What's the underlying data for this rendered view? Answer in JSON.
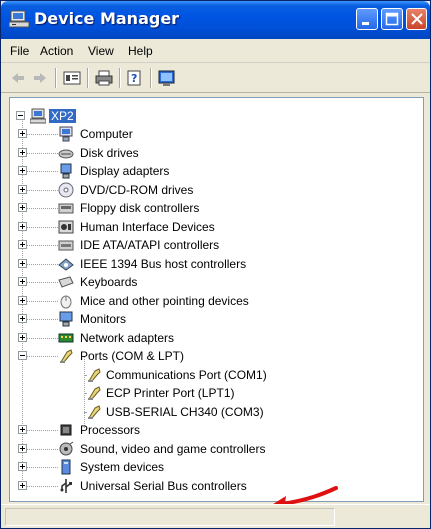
{
  "window": {
    "title": "Device Manager",
    "title_icon": "device-manager-icon"
  },
  "menu": [
    "File",
    "Action",
    "View",
    "Help"
  ],
  "toolbar": [
    "back-icon",
    "forward-icon",
    "properties-view-icon",
    "print-icon",
    "help-icon",
    "scan-hardware-icon"
  ],
  "tree": {
    "root": "XP2",
    "items": [
      {
        "label": "Computer",
        "icon": "computer-icon"
      },
      {
        "label": "Disk drives",
        "icon": "disk-drive-icon"
      },
      {
        "label": "Display adapters",
        "icon": "display-adapter-icon"
      },
      {
        "label": "DVD/CD-ROM drives",
        "icon": "dvd-drive-icon"
      },
      {
        "label": "Floppy disk controllers",
        "icon": "floppy-controller-icon"
      },
      {
        "label": "Human Interface Devices",
        "icon": "hid-icon"
      },
      {
        "label": "IDE ATA/ATAPI controllers",
        "icon": "ide-controller-icon"
      },
      {
        "label": "IEEE 1394 Bus host controllers",
        "icon": "ieee1394-icon"
      },
      {
        "label": "Keyboards",
        "icon": "keyboard-icon"
      },
      {
        "label": "Mice and other pointing devices",
        "icon": "mouse-icon"
      },
      {
        "label": "Monitors",
        "icon": "monitor-icon"
      },
      {
        "label": "Network adapters",
        "icon": "network-adapter-icon"
      },
      {
        "label": "Ports (COM & LPT)",
        "icon": "port-icon"
      },
      {
        "label": "Processors",
        "icon": "processor-icon"
      },
      {
        "label": "Sound, video and game controllers",
        "icon": "sound-icon"
      },
      {
        "label": "System devices",
        "icon": "system-device-icon"
      },
      {
        "label": "Universal Serial Bus controllers",
        "icon": "usb-icon"
      }
    ],
    "ports_children": [
      {
        "label": "Communications Port (COM1)",
        "icon": "port-icon"
      },
      {
        "label": "ECP Printer Port (LPT1)",
        "icon": "port-icon"
      },
      {
        "label": "USB-SERIAL CH340 (COM3)",
        "icon": "port-icon"
      }
    ]
  },
  "annotation": {
    "color": "#e01010",
    "icon": "red-arrow-icon"
  }
}
